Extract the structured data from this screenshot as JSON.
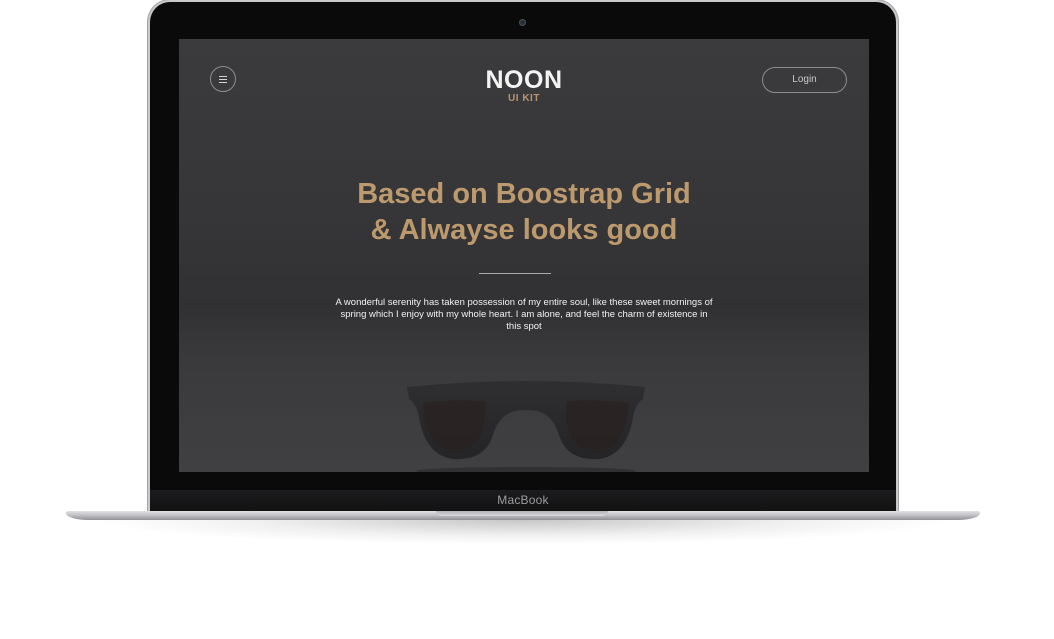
{
  "device": {
    "brand_label": "MacBook"
  },
  "site": {
    "nav": {
      "menu_icon": "hamburger-icon",
      "logo_main": "NOON",
      "logo_sub": "UI KIT",
      "login_label": "Login"
    },
    "hero": {
      "headline_line1": "Based on Boostrap Grid",
      "headline_line2": "& Alwayse looks good",
      "body": "A wonderful serenity has taken possession of my entire soul, like these sweet mornings of spring which I enjoy with my whole heart. I am alone, and feel the charm of existence in this spot",
      "background_image": "sunglasses-photo"
    }
  },
  "colors": {
    "accent": "#bd9a6e",
    "screen_bg": "#363638",
    "text_light": "#f2f2f2"
  }
}
